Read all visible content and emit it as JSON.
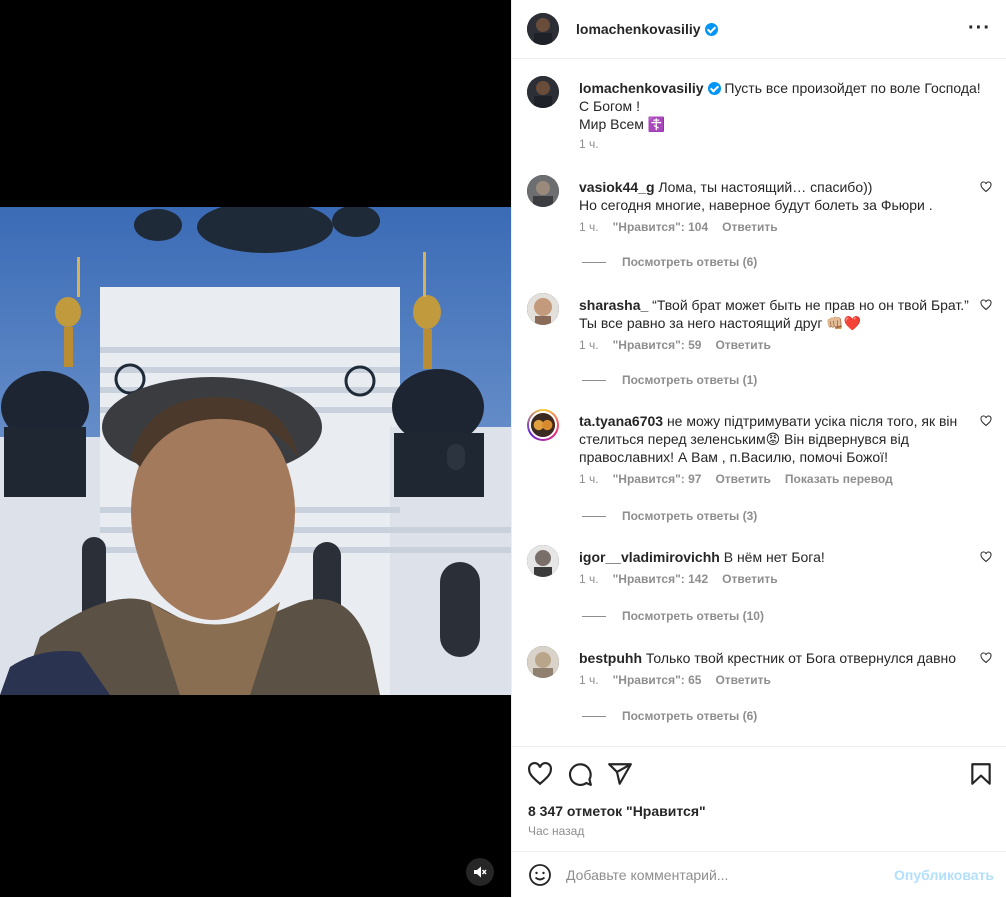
{
  "post": {
    "author": "lomachenkovasiliy",
    "caption_lines": [
      "Пусть все произойдет по воле Господа!",
      "С Богом !",
      "Мир Всем ☦️"
    ],
    "caption_time": "1 ч.",
    "likes_text": "8 347 отметок \"Нравится\"",
    "time_text": "Час назад"
  },
  "comments": [
    {
      "user": "vasiok44_g",
      "text": "Лома, ты настоящий… спасибо))",
      "text2": "Но сегодня многие, наверное будут болеть за Фьюри .",
      "time": "1 ч.",
      "likes": "\"Нравится\": 104",
      "reply": "Ответить",
      "view_replies": "Посмотреть ответы (6)"
    },
    {
      "user": "sharasha_",
      "text": "“Твой брат может быть не прав но он твой Брат.”",
      "text2": "Ты все равно за него настоящий друг 👊🏼❤️",
      "time": "1 ч.",
      "likes": "\"Нравится\": 59",
      "reply": "Ответить",
      "view_replies": "Посмотреть ответы (1)"
    },
    {
      "user": "ta.tyana6703",
      "text": "не можу підтримувати усіка після того, як він",
      "text2": "стелиться перед зеленським😡 Він відвернувся від",
      "text3": "православних! А Вам , п.Василю, помочі Божої!",
      "time": "1 ч.",
      "likes": "\"Нравится\": 97",
      "reply": "Ответить",
      "translate": "Показать перевод",
      "view_replies": "Посмотреть ответы (3)"
    },
    {
      "user": "igor__vladimirovichh",
      "text": "В нём нет Бога!",
      "time": "1 ч.",
      "likes": "\"Нравится\": 142",
      "reply": "Ответить",
      "view_replies": "Посмотреть ответы (10)"
    },
    {
      "user": "bestpuhh",
      "text": "Только твой крестник от Бога отвернулся давно",
      "time": "1 ч.",
      "likes": "\"Нравится\": 65",
      "reply": "Ответить",
      "view_replies": "Посмотреть ответы (6)"
    }
  ],
  "composer": {
    "placeholder": "Добавьте комментарий...",
    "post_label": "Опубликовать"
  },
  "icons": {
    "more": "more-options-icon",
    "heart": "heart-icon",
    "comment": "comment-icon",
    "share": "share-icon",
    "save": "bookmark-icon",
    "emoji": "emoji-icon",
    "mute": "speaker-muted-icon",
    "verified": "verified-badge-icon"
  },
  "colors": {
    "link": "#0095f6",
    "muted_text": "#8e8e8e",
    "post_button_disabled": "#b2dffc"
  }
}
